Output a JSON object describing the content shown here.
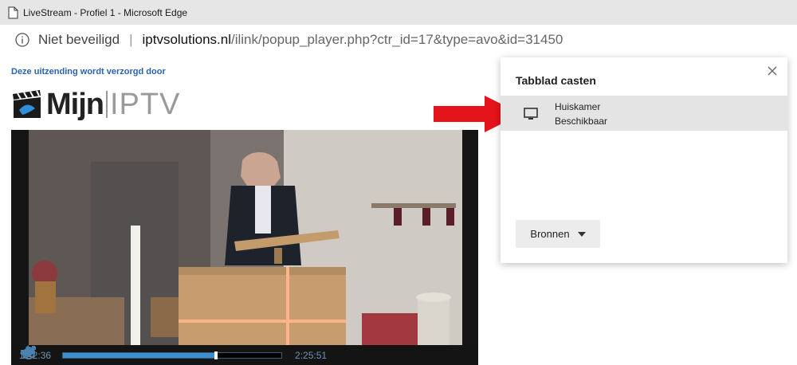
{
  "window": {
    "title": "LiveStream - Profiel 1 - Microsoft Edge"
  },
  "address_bar": {
    "security_label": "Niet beveiligd",
    "host": "iptvsolutions.nl",
    "path": "/ilink/popup_player.php?ctr_id=17&type=avo&id=31450"
  },
  "page": {
    "sponsor_text": "Deze uitzending wordt verzorgd door",
    "logo_text_bold": "Mijn",
    "logo_text_light": "IPTV"
  },
  "player": {
    "current_time": "1:42:36",
    "duration": "2:25:51",
    "progress_fraction": 0.7
  },
  "cast": {
    "heading": "Tabblad casten",
    "devices": [
      {
        "name": "Huiskamer",
        "status": "Beschikbaar"
      }
    ],
    "sources_label": "Bronnen"
  },
  "icons": {
    "page": "page-icon",
    "info": "info-icon",
    "close": "close-icon",
    "monitor": "monitor-icon",
    "dropdown": "caret-down-icon",
    "play": "play-icon",
    "replay": "replay-10-icon",
    "volume": "volume-icon",
    "fullscreen": "fullscreen-icon",
    "arrow": "red-arrow-icon"
  },
  "colors": {
    "arrow_red": "#e5141b",
    "link_blue": "#2a62b4",
    "player_accent": "#3b8fd0"
  }
}
